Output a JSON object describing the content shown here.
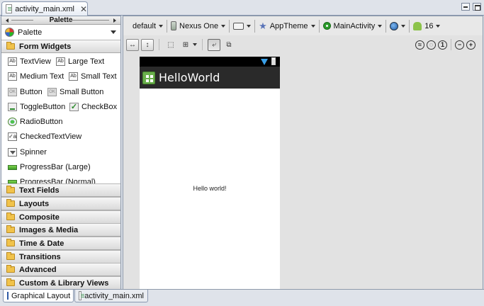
{
  "editor_tab": {
    "title": "activity_main.xml",
    "close_glyph": "✕"
  },
  "palette": {
    "header": "Palette",
    "selector_label": "Palette",
    "categories": [
      {
        "label": "Form Widgets",
        "expanded": true
      },
      {
        "label": "Text Fields"
      },
      {
        "label": "Layouts"
      },
      {
        "label": "Composite"
      },
      {
        "label": "Images & Media"
      },
      {
        "label": "Time & Date"
      },
      {
        "label": "Transitions"
      },
      {
        "label": "Advanced"
      },
      {
        "label": "Custom & Library Views"
      }
    ],
    "widgets": {
      "textview": "TextView",
      "large_text": "Large Text",
      "medium_text": "Medium Text",
      "small_text": "Small Text",
      "button": "Button",
      "small_button": "Small Button",
      "toggle_button": "ToggleButton",
      "checkbox": "CheckBox",
      "radio_button": "RadioButton",
      "checked_text_view": "CheckedTextView",
      "spinner": "Spinner",
      "progress_large": "ProgressBar (Large)",
      "progress_normal": "ProgressBar (Normal)"
    },
    "icon_glyphs": {
      "text": "Ab",
      "button": "OK",
      "checked": "✓a",
      "check": "✓"
    }
  },
  "config_bar": {
    "config": "default",
    "device": "Nexus One",
    "theme": "AppTheme",
    "activity": "MainActivity",
    "api_level": "16"
  },
  "zoom_bar": {
    "glyphs": {
      "fill_width": "↔",
      "fill_height": "↕",
      "zoom_best": "≈",
      "zoom_fit": "◌",
      "zoom_100": "1",
      "zoom_out": "−",
      "zoom_in": "+"
    }
  },
  "preview": {
    "app_title": "HelloWorld",
    "body_text": "Hello world!"
  },
  "bottom_tabs": {
    "graphical_layout": "Graphical Layout",
    "xml_source": "activity_main.xml"
  }
}
